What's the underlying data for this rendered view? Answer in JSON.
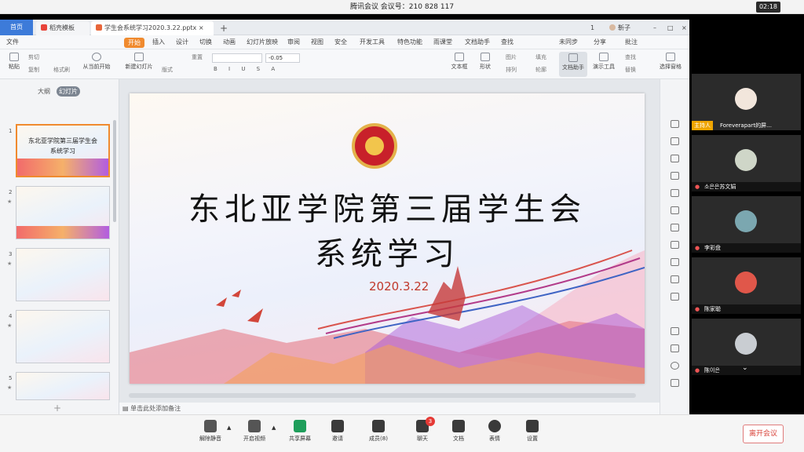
{
  "meeting": {
    "title": "腾讯会议 会议号：210 828 117",
    "clock": "02:18"
  },
  "wps": {
    "tabs": {
      "home": "首页",
      "template": "稻壳模板",
      "file": "学生会系统学习2020.3.22.pptx",
      "user": "靳子",
      "page_count": "1"
    },
    "menu": [
      "文件",
      "开始",
      "插入",
      "设计",
      "切换",
      "动画",
      "幻灯片放映",
      "审阅",
      "视图",
      "安全",
      "开发工具",
      "特色功能",
      "雨课堂",
      "文档助手",
      "查找"
    ],
    "menu_right": [
      "未同步",
      "分享",
      "批注"
    ],
    "ribbon": {
      "paste": "粘贴",
      "cut": "剪切",
      "copy": "复制",
      "format_painter": "格式刷",
      "from_current": "从当前开始",
      "new_slide": "新建幻灯片",
      "layout": "版式",
      "reset": "重置",
      "font_size": "-0.05",
      "textbox": "文本框",
      "shape": "形状",
      "picture": "图片",
      "arrange": "排列",
      "fill": "填充",
      "outline": "轮廓",
      "doc_helper": "文档助手",
      "presentation_tools": "演示工具",
      "find": "查找",
      "replace": "替换",
      "select_pane": "选择窗格"
    },
    "left_panel": {
      "tab_outline": "大纲",
      "tab_slides": "幻灯片",
      "slides": [
        {
          "num": "1",
          "title_a": "东北亚学院第三届学生会",
          "title_b": "系统学习"
        },
        {
          "num": "2"
        },
        {
          "num": "3"
        },
        {
          "num": "4"
        },
        {
          "num": "5"
        }
      ],
      "add": "+"
    },
    "slide": {
      "title_line1": "东北亚学院第三届学生会",
      "title_line2": "系统学习",
      "date": "2020.3.22"
    },
    "notes_placeholder": "单击此处添加备注"
  },
  "participants": [
    {
      "name": "Foreverapart的屏…",
      "host_tag": "主持人",
      "color": "#f2e6dc"
    },
    {
      "name": "소은은苏文娟",
      "color": "#cfd6c8"
    },
    {
      "name": "李彩盘",
      "color": "#7ba7b0"
    },
    {
      "name": "陈家聪",
      "color": "#e0574a"
    },
    {
      "name": "陈이은",
      "color": "#c9cdd2"
    }
  ],
  "toolbar": {
    "mute": "解除静音",
    "video": "开启视频",
    "share": "共享屏幕",
    "invite": "邀请",
    "members": "成员(8)",
    "chat": "聊天",
    "chat_badge": "3",
    "docs": "文档",
    "emoji": "表情",
    "settings": "设置",
    "leave": "离开会议"
  }
}
